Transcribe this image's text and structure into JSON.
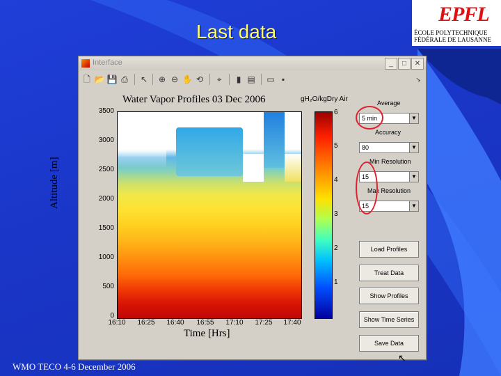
{
  "slide": {
    "title": "Last data",
    "footer": "WMO TECO 4-6 December 2006",
    "logo": {
      "mark": "EPFL",
      "line1": "ÉCOLE POLYTECHNIQUE",
      "line2": "FÉDÉRALE DE LAUSANNE"
    }
  },
  "window": {
    "title": "Interface",
    "toolbar": [
      "new-icon",
      "open-icon",
      "save-icon",
      "print-icon",
      "pointer-icon",
      "zoom-in-icon",
      "zoom-out-icon",
      "pan-icon",
      "rotate-icon",
      "datacursor-icon",
      "colorbar-icon",
      "legend-icon",
      "hide-icon",
      "grid-icon"
    ]
  },
  "plot": {
    "title": "Water Vapor Profiles   03 Dec 2006",
    "cbar_label": "gH₂O/kgDry Air",
    "xlabel": "Time [Hrs]",
    "ylabel": "Altitude [m]",
    "yticks": [
      "3500",
      "3000",
      "2500",
      "2000",
      "1500",
      "1000",
      "500",
      "0"
    ],
    "xticks": [
      "16:10",
      "16:25",
      "16:40",
      "16:55",
      "17:10",
      "17:25",
      "17:40"
    ],
    "cticks": [
      "6",
      "5",
      "4",
      "3",
      "2",
      "1"
    ]
  },
  "chart_data": {
    "type": "heatmap",
    "title": "Water Vapor Profiles   03 Dec 2006",
    "xlabel": "Time [Hrs]",
    "ylabel": "Altitude [m]",
    "colorbar_label": "gH2O/kgDry Air",
    "xlim": [
      "16:10",
      "17:40"
    ],
    "ylim": [
      0,
      3500
    ],
    "clim": [
      1,
      6
    ],
    "x_ticks": [
      "16:10",
      "16:25",
      "16:40",
      "16:55",
      "17:10",
      "17:25",
      "17:40"
    ],
    "y_ticks": [
      0,
      500,
      1000,
      1500,
      2000,
      2500,
      3000,
      3500
    ],
    "c_ticks": [
      1,
      2,
      3,
      4,
      5,
      6
    ]
  },
  "controls": {
    "average_label": "Average",
    "average_value": "5 min",
    "accuracy_label": "Accuracy",
    "accuracy_value": "80",
    "minres_label": "Min Resolution",
    "minres_value": "15",
    "maxres_label": "Max Resolution",
    "maxres_value": "15",
    "buttons": [
      "Load Profiles",
      "Treat Data",
      "Show Profiles",
      "Show Time Series",
      "Save Data"
    ]
  },
  "colors": {
    "background": "#1a36c8",
    "title": "#ffff66",
    "highlight_ring": "#e0202c"
  }
}
